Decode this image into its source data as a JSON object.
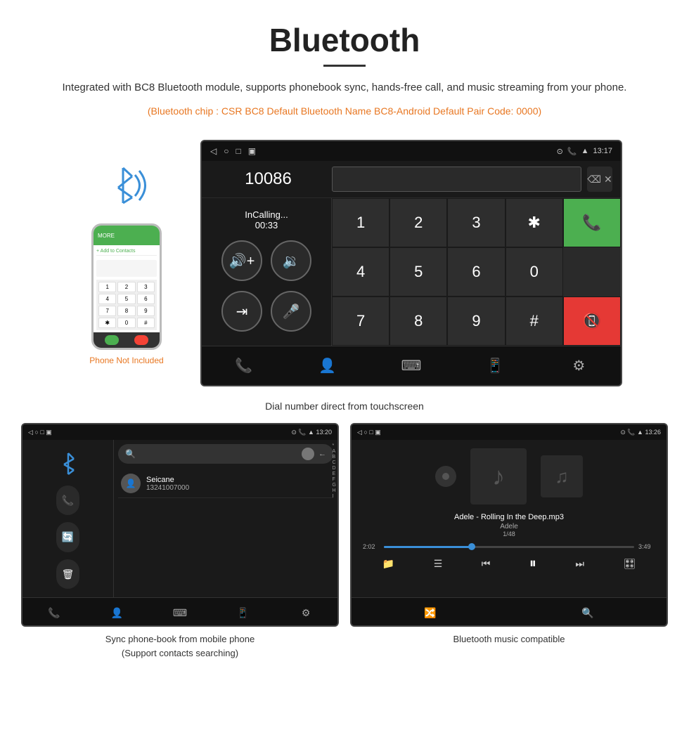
{
  "page": {
    "title": "Bluetooth",
    "subtitle": "Integrated with BC8 Bluetooth module, supports phonebook sync, hands-free call, and music streaming from your phone.",
    "orange_note": "(Bluetooth chip : CSR BC8    Default Bluetooth Name BC8-Android    Default Pair Code: 0000)"
  },
  "phone_graphic": {
    "not_included": "Phone Not Included"
  },
  "dial_screen": {
    "time": "13:17",
    "number": "10086",
    "call_label": "InCalling...",
    "call_timer": "00:33",
    "keys": [
      "1",
      "2",
      "3",
      "✱",
      "",
      "4",
      "5",
      "6",
      "0",
      "",
      "7",
      "8",
      "9",
      "#",
      ""
    ],
    "caption": "Dial number direct from touchscreen"
  },
  "phonebook_screen": {
    "time": "13:20",
    "contact_name": "Seicane",
    "contact_phone": "13241007000",
    "alpha_list": [
      "*",
      "A",
      "B",
      "C",
      "D",
      "E",
      "F",
      "G",
      "H",
      "I"
    ],
    "caption_line1": "Sync phone-book from mobile phone",
    "caption_line2": "(Support contacts searching)"
  },
  "music_screen": {
    "time": "13:26",
    "track_name": "Adele - Rolling In the Deep.mp3",
    "artist": "Adele",
    "count": "1/48",
    "time_current": "2:02",
    "time_total": "3:49",
    "progress_percent": 35,
    "caption": "Bluetooth music compatible"
  }
}
